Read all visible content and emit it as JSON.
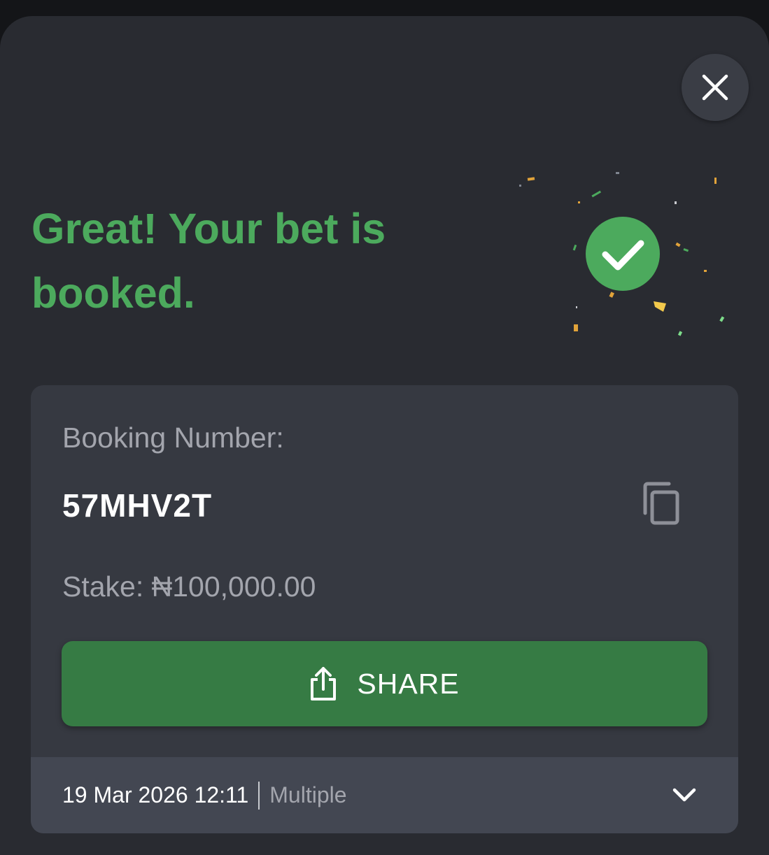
{
  "modal": {
    "headline": "Great! Your bet is booked.",
    "close_icon": "close-icon",
    "success_icon": "check-circle-icon"
  },
  "booking": {
    "label": "Booking Number:",
    "code": "57MHV2T",
    "copy_icon": "copy-icon",
    "stake": "Stake: ₦100,000.00"
  },
  "share": {
    "label": "SHARE",
    "icon": "share-icon"
  },
  "footer": {
    "datetime": "19 Mar 2026 12:11",
    "bet_type": "Multiple",
    "expand_icon": "chevron-down-icon"
  },
  "colors": {
    "success_green": "#4caa5d",
    "button_green": "#367b44",
    "modal_bg": "#292b31",
    "card_bg": "#363941",
    "footer_bg": "#434752"
  }
}
